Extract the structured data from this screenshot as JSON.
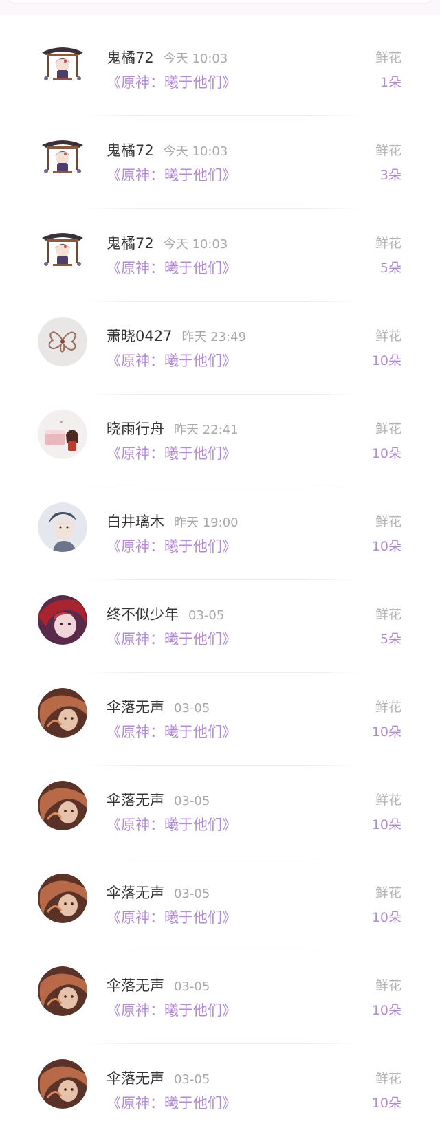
{
  "records": [
    {
      "name": "鬼橘72",
      "time": "今天 10:03",
      "book": "《原神：曦于他们》",
      "gift": "鲜花",
      "count": "1朵",
      "avatar": "pavilion-icon"
    },
    {
      "name": "鬼橘72",
      "time": "今天 10:03",
      "book": "《原神：曦于他们》",
      "gift": "鲜花",
      "count": "3朵",
      "avatar": "pavilion-icon"
    },
    {
      "name": "鬼橘72",
      "time": "今天 10:03",
      "book": "《原神：曦于他们》",
      "gift": "鲜花",
      "count": "5朵",
      "avatar": "pavilion-icon"
    },
    {
      "name": "萧晓0427",
      "time": "昨天 23:49",
      "book": "《原神：曦于他们》",
      "gift": "鲜花",
      "count": "10朵",
      "avatar": "flower-avatar"
    },
    {
      "name": "晓雨行舟",
      "time": "昨天 22:41",
      "book": "《原神：曦于他们》",
      "gift": "鲜花",
      "count": "10朵",
      "avatar": "cake-avatar"
    },
    {
      "name": "白井璃木",
      "time": "昨天 19:00",
      "book": "《原神：曦于他们》",
      "gift": "鲜花",
      "count": "10朵",
      "avatar": "portrait-avatar"
    },
    {
      "name": "终不似少年",
      "time": "03-05",
      "book": "《原神：曦于他们》",
      "gift": "鲜花",
      "count": "5朵",
      "avatar": "redhair-avatar"
    },
    {
      "name": "伞落无声",
      "time": "03-05",
      "book": "《原神：曦于他们》",
      "gift": "鲜花",
      "count": "10朵",
      "avatar": "brown-avatar"
    },
    {
      "name": "伞落无声",
      "time": "03-05",
      "book": "《原神：曦于他们》",
      "gift": "鲜花",
      "count": "10朵",
      "avatar": "brown-avatar"
    },
    {
      "name": "伞落无声",
      "time": "03-05",
      "book": "《原神：曦于他们》",
      "gift": "鲜花",
      "count": "10朵",
      "avatar": "brown-avatar"
    },
    {
      "name": "伞落无声",
      "time": "03-05",
      "book": "《原神：曦于他们》",
      "gift": "鲜花",
      "count": "10朵",
      "avatar": "brown-avatar"
    },
    {
      "name": "伞落无声",
      "time": "03-05",
      "book": "《原神：曦于他们》",
      "gift": "鲜花",
      "count": "10朵",
      "avatar": "brown-avatar"
    }
  ],
  "colors": {
    "accent": "#b18ad0",
    "name_text": "#333333",
    "muted_text": "#a8a8a8"
  }
}
